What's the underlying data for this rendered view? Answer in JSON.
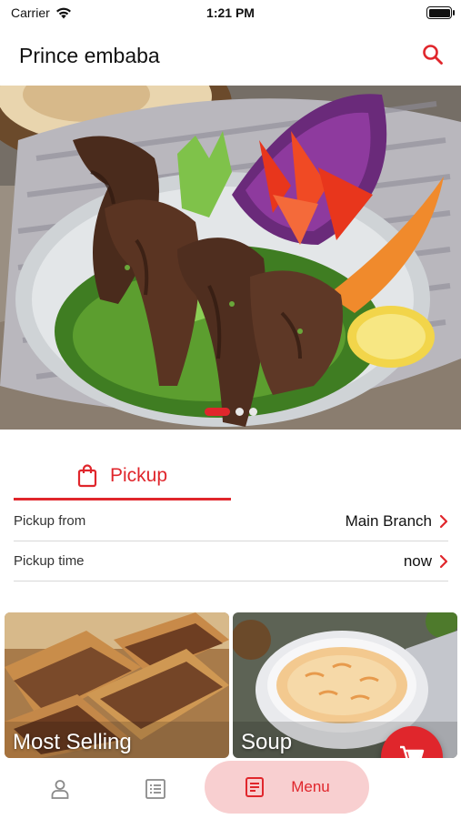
{
  "status_bar": {
    "carrier": "Carrier",
    "time": "1:21 PM"
  },
  "header": {
    "title": "Prince embaba"
  },
  "carousel": {
    "slide_count": 3,
    "active_index": 0
  },
  "order_type": {
    "tab_label": "Pickup",
    "rows": [
      {
        "label": "Pickup from",
        "value": "Main Branch"
      },
      {
        "label": "Pickup time",
        "value": "now"
      }
    ]
  },
  "categories": [
    {
      "name": "Most Selling"
    },
    {
      "name": "Soup"
    }
  ],
  "bottom_nav": {
    "active_label": "Menu"
  },
  "colors": {
    "accent": "#e0262c",
    "accent_soft": "#f8cfd0"
  },
  "icons": [
    "wifi-icon",
    "battery-icon",
    "search-icon",
    "shopping-bag-icon",
    "chevron-right-icon",
    "cart-icon",
    "person-icon",
    "list-icon",
    "menu-doc-icon"
  ]
}
